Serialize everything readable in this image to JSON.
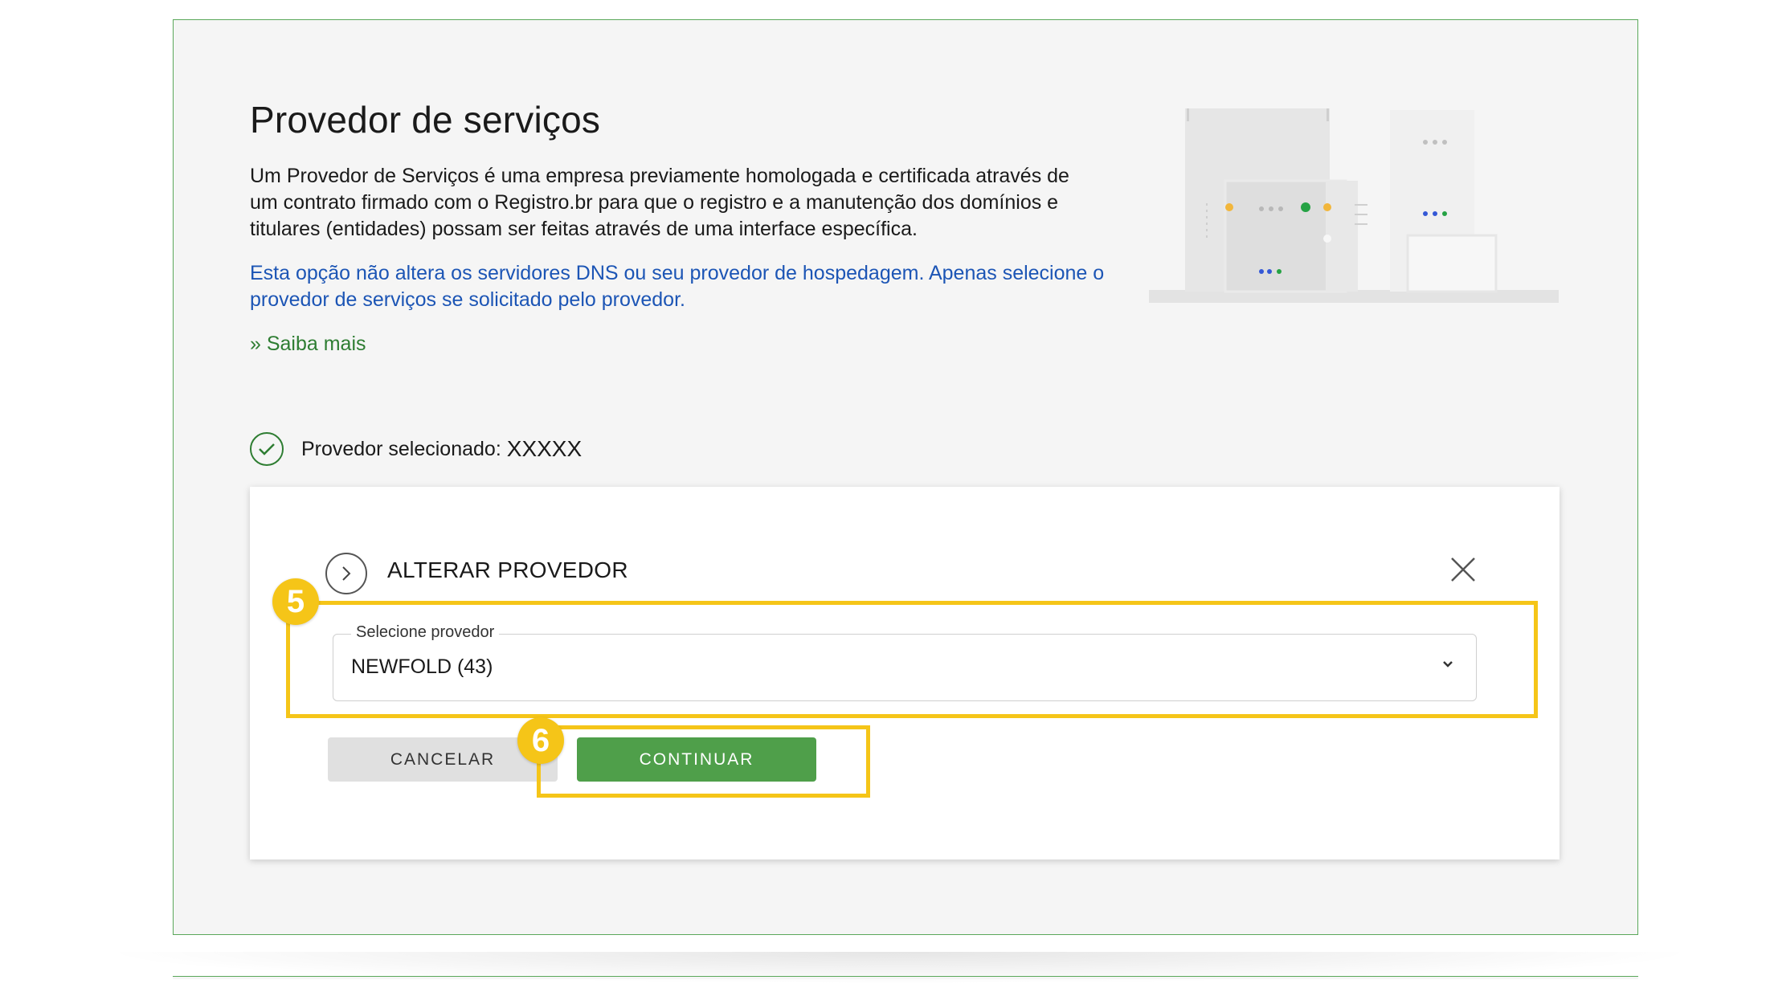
{
  "page": {
    "title": "Provedor de serviços",
    "description": "Um Provedor de Serviços é uma empresa previamente homologada e certificada através de um contrato firmado com o Registro.br para que o registro e a manutenção dos domínios e titulares (entidades) possam ser feitas através de uma interface específica.",
    "note": "Esta opção não altera os servidores DNS ou seu provedor de hospedagem. Apenas selecione o provedor de serviços se solicitado pelo provedor.",
    "learn_more": "» Saiba mais"
  },
  "selected_provider": {
    "label": "Provedor selecionado:",
    "value": "XXXXX",
    "icon": "check-circle-icon"
  },
  "change_provider": {
    "title": "ALTERAR PROVEDOR",
    "select_label": "Selecione provedor",
    "select_value": "NEWFOLD (43)",
    "cancel_label": "CANCELAR",
    "continue_label": "CONTINUAR"
  },
  "annotations": [
    {
      "number": "5"
    },
    {
      "number": "6"
    }
  ],
  "colors": {
    "accent_green": "#4f9f4a",
    "link_blue": "#1c55b5",
    "highlight_yellow": "#f5c518",
    "panel_border": "#5aa85a"
  }
}
